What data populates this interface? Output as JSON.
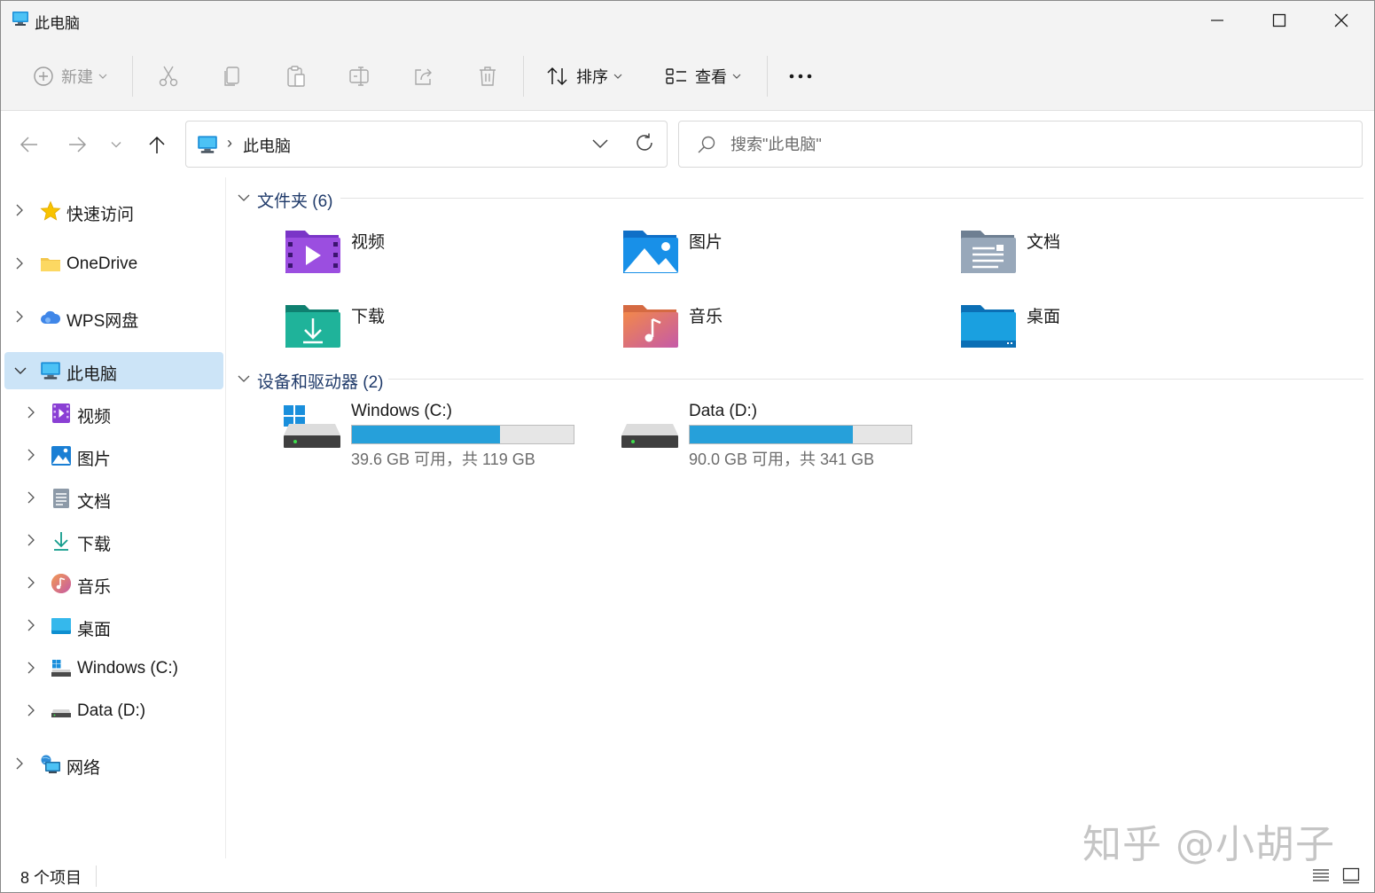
{
  "window": {
    "title": "此电脑"
  },
  "toolbar": {
    "new_label": "新建",
    "sort_label": "排序",
    "view_label": "查看",
    "more_label": "···"
  },
  "address": {
    "path": "此电脑",
    "separator": "›"
  },
  "search": {
    "placeholder": "搜索\"此电脑\""
  },
  "sidebar": {
    "items": [
      {
        "label": "快速访问",
        "icon": "star-icon"
      },
      {
        "label": "OneDrive",
        "icon": "folder-icon"
      },
      {
        "label": "WPS网盘",
        "icon": "cloud-icon"
      },
      {
        "label": "此电脑",
        "icon": "computer-icon",
        "selected": true,
        "expanded": true
      },
      {
        "label": "视频",
        "icon": "video-icon"
      },
      {
        "label": "图片",
        "icon": "pictures-icon"
      },
      {
        "label": "文档",
        "icon": "documents-icon"
      },
      {
        "label": "下载",
        "icon": "download-icon"
      },
      {
        "label": "音乐",
        "icon": "music-icon"
      },
      {
        "label": "桌面",
        "icon": "desktop-icon"
      },
      {
        "label": "Windows (C:)",
        "icon": "windows-drive-icon"
      },
      {
        "label": "Data (D:)",
        "icon": "drive-icon"
      },
      {
        "label": "网络",
        "icon": "network-icon"
      }
    ]
  },
  "content": {
    "folders_header": "文件夹 (6)",
    "folders": [
      {
        "label": "视频",
        "icon": "video-folder-icon"
      },
      {
        "label": "图片",
        "icon": "pictures-folder-icon"
      },
      {
        "label": "文档",
        "icon": "documents-folder-icon"
      },
      {
        "label": "下载",
        "icon": "downloads-folder-icon"
      },
      {
        "label": "音乐",
        "icon": "music-folder-icon"
      },
      {
        "label": "桌面",
        "icon": "desktop-folder-icon"
      }
    ],
    "drives_header": "设备和驱动器 (2)",
    "drives": [
      {
        "name": "Windows (C:)",
        "free_text": "39.6 GB 可用，共 119 GB",
        "used_fraction": 0.667
      },
      {
        "name": "Data (D:)",
        "free_text": "90.0 GB 可用，共 341 GB",
        "used_fraction": 0.736
      }
    ]
  },
  "status": {
    "item_count": "8 个项目"
  },
  "watermark": "知乎 @小胡子",
  "colors": {
    "accent": "#26a0da",
    "selection": "#cce4f7",
    "group_header": "#1f3a6a"
  }
}
